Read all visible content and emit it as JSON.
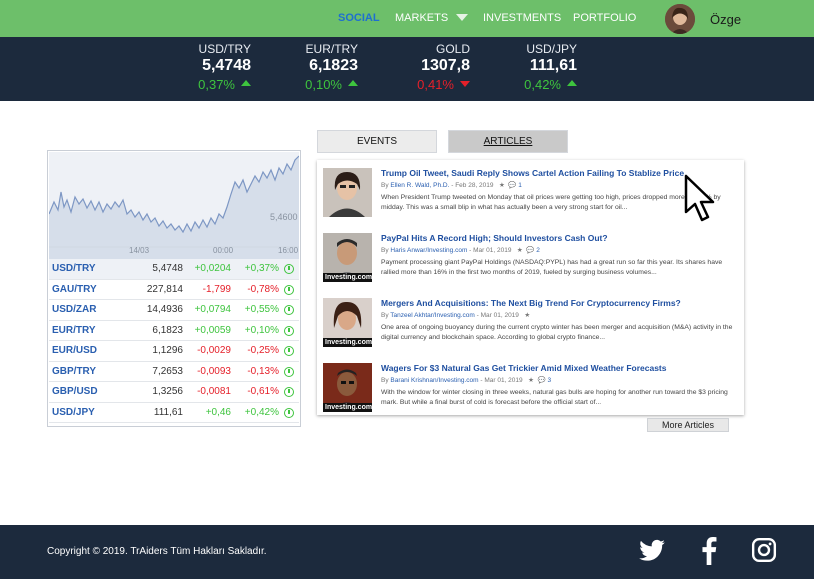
{
  "nav": {
    "items": [
      {
        "label": "SOCIAL",
        "active": true
      },
      {
        "label": "MARKETS",
        "active": false
      },
      {
        "label": "INVESTMENTS",
        "active": false
      },
      {
        "label": "PORTFOLIO",
        "active": false
      }
    ],
    "user_name": "Özge"
  },
  "ticker": [
    {
      "symbol": "USD/TRY",
      "value": "5,4748",
      "change": "0,37%",
      "direction": "up"
    },
    {
      "symbol": "EUR/TRY",
      "value": "6,1823",
      "change": "0,10%",
      "direction": "up"
    },
    {
      "symbol": "GOLD",
      "value": "1307,8",
      "change": "0,41%",
      "direction": "down"
    },
    {
      "symbol": "USD/JPY",
      "value": "111,61",
      "change": "0,42%",
      "direction": "up"
    }
  ],
  "mini_chart": {
    "price_label": "5,4600",
    "x_ticks": [
      "14/03",
      "00:00",
      "16:00"
    ]
  },
  "rates": [
    {
      "symbol": "USD/TRY",
      "value": "5,4748",
      "change": "+0,0204",
      "percent": "+0,37%",
      "direction": "up"
    },
    {
      "symbol": "GAU/TRY",
      "value": "227,814",
      "change": "-1,799",
      "percent": "-0,78%",
      "direction": "down"
    },
    {
      "symbol": "USD/ZAR",
      "value": "14,4936",
      "change": "+0,0794",
      "percent": "+0,55%",
      "direction": "up"
    },
    {
      "symbol": "EUR/TRY",
      "value": "6,1823",
      "change": "+0,0059",
      "percent": "+0,10%",
      "direction": "up"
    },
    {
      "symbol": "EUR/USD",
      "value": "1,1296",
      "change": "-0,0029",
      "percent": "-0,25%",
      "direction": "down"
    },
    {
      "symbol": "GBP/TRY",
      "value": "7,2653",
      "change": "-0,0093",
      "percent": "-0,13%",
      "direction": "down"
    },
    {
      "symbol": "GBP/USD",
      "value": "1,3256",
      "change": "-0,0081",
      "percent": "-0,61%",
      "direction": "down"
    },
    {
      "symbol": "USD/JPY",
      "value": "111,61",
      "change": "+0,46",
      "percent": "+0,42%",
      "direction": "up"
    }
  ],
  "tabs": {
    "events": "EVENTS",
    "articles": "ARTICLES"
  },
  "articles": [
    {
      "title": "Trump Oil Tweet, Saudi Reply Shows Cartel Action Failing To Stablize Price",
      "author": "Ellen R. Wald, Ph.D.",
      "date": "- Feb 28, 2019",
      "comments": "1",
      "text": "When President Trump tweeted on Monday that oil prices were getting too high, prices dropped more than 3% by midday. This was a small blip in what has actually been a very strong start for oil...",
      "badge": ""
    },
    {
      "title": "PayPal Hits A Record High; Should Investors Cash Out?",
      "author": "Haris Anwar/Investing.com",
      "date": "- Mar 01, 2019",
      "comments": "2",
      "text": "Payment processing giant PayPal Holdings (NASDAQ:PYPL) has had a great run so far this year. Its shares have rallied more than 16% in the first two months of 2019, fueled by surging business volumes...",
      "badge": "Investing.com"
    },
    {
      "title": "Mergers And Acquisitions: The Next Big Trend For Cryptocurrency Firms?",
      "author": "Tanzeel Akhtar/Investing.com",
      "date": "- Mar 01, 2019",
      "comments": "",
      "text": "One area of ongoing buoyancy during the current crypto winter has been merger and acquisition (M&A) activity in the digital currency and blockchain space. According to global crypto finance...",
      "badge": "Investing.com"
    },
    {
      "title": "Wagers For $3 Natural Gas Get Trickier Amid Mixed Weather Forecasts",
      "author": "Barani Krishnan/Investing.com",
      "date": "- Mar 01, 2019",
      "comments": "3",
      "text": "With the window for winter closing in three weeks, natural gas bulls are hoping for another run toward the $3 pricing mark. But while a final burst of cold is forecast before the official start of...",
      "badge": "Investing.com"
    }
  ],
  "more_articles": "More Articles",
  "footer": {
    "copyright": "Copyright © 2019. TrAiders Tüm Hakları Sakladır."
  },
  "colors": {
    "nav_green": "#6dbf6a",
    "navy": "#1c2a3d",
    "up": "#3ec43e",
    "down": "#e5202a",
    "link": "#1f4fa0"
  }
}
